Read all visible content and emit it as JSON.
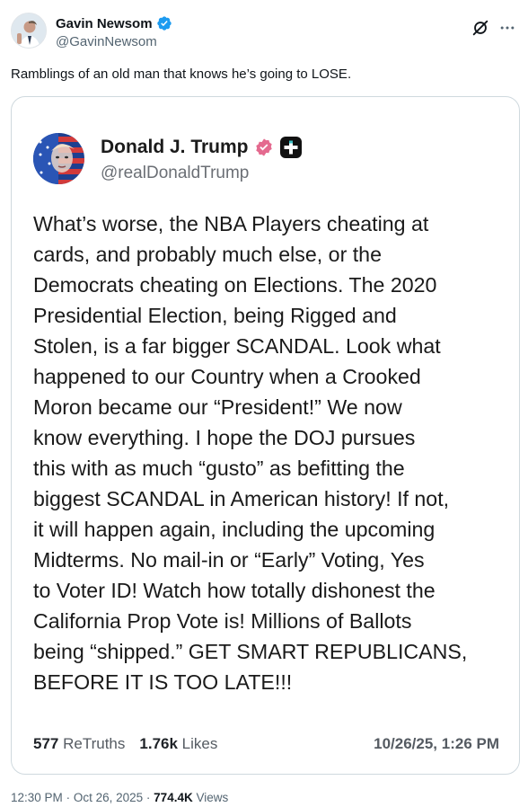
{
  "post": {
    "author_name": "Gavin Newsom",
    "author_handle": "@GavinNewsom",
    "text": "Ramblings of an old man that knows he’s going to LOSE.",
    "time": "12:30 PM",
    "date": "Oct 26, 2025",
    "separator": "·",
    "views_count": "774.4K",
    "views_label": "Views"
  },
  "embedded": {
    "author_name": "Donald J. Trump",
    "author_handle": "@realDonaldTrump",
    "body_lines": [
      "What’s worse, the NBA Players cheating at",
      "cards, and probably much else, or the",
      "Democrats cheating on Elections. The 2020",
      "Presidential Election, being Rigged and",
      "Stolen, is a far bigger SCANDAL. Look what",
      "happened to our Country when a Crooked",
      "Moron became our “President!” We now",
      "know everything. I hope the DOJ pursues",
      "this with as much “gusto” as befitting the",
      "biggest SCANDAL in American history! If not,",
      "it will happen again, including the upcoming",
      "Midterms. No mail-in or “Early” Voting, Yes",
      "to Voter ID! Watch how totally dishonest the",
      "California Prop Vote is! Millions of Ballots",
      "being “shipped.” GET SMART REPUBLICANS,",
      "BEFORE IT IS TOO LATE!!!"
    ],
    "retruths_count": "577",
    "retruths_label": "ReTruths",
    "likes_count": "1.76k",
    "likes_label": "Likes",
    "timestamp": "10/26/25, 1:26 PM"
  },
  "icons": {
    "verified": "verified-badge-icon",
    "grok": "grok-icon",
    "more": "more-icon",
    "truth_verified": "truth-verified-icon",
    "truth_plus": "truth-plus-icon"
  },
  "colors": {
    "verified_blue": "#1d9bf0",
    "truth_badge_pink": "#e46a8f",
    "secondary_text": "#536471"
  }
}
